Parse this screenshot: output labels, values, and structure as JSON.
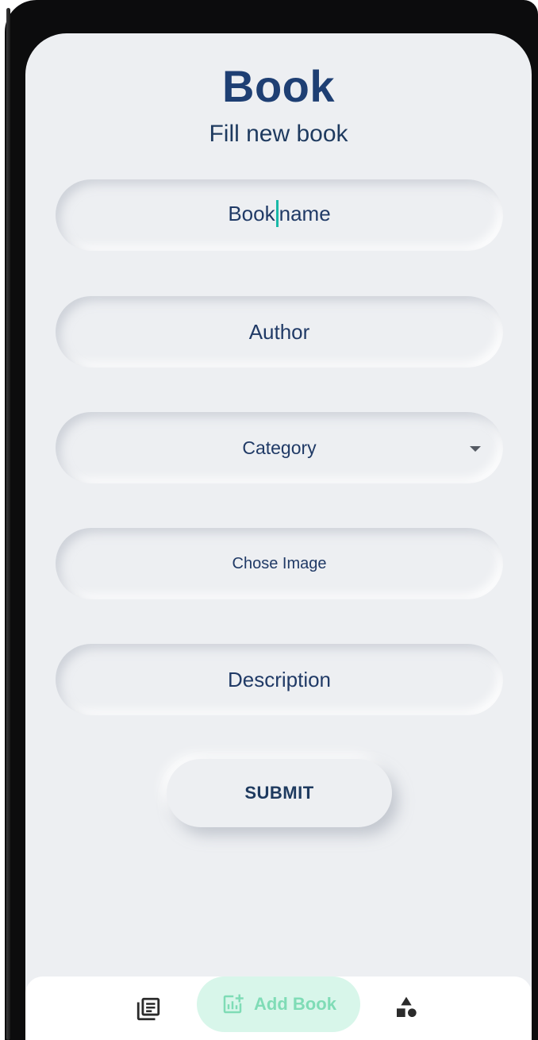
{
  "header": {
    "title": "Book",
    "subtitle": "Fill new book"
  },
  "form": {
    "book_name": {
      "before_cursor": "Book",
      "after_cursor": "name"
    },
    "author": {
      "placeholder": "Author"
    },
    "category": {
      "placeholder": "Category"
    },
    "image": {
      "placeholder": "Chose Image"
    },
    "description": {
      "placeholder": "Description"
    },
    "submit_label": "SUBMIT"
  },
  "bottom_nav": {
    "items": [
      {
        "icon": "library-books-icon",
        "active": false
      },
      {
        "icon": "add-chart-icon",
        "label": "Add Book",
        "active": true
      },
      {
        "icon": "category-shapes-icon",
        "active": false
      }
    ]
  },
  "colors": {
    "background": "#edeff2",
    "title": "#1e3f73",
    "cursor": "#19b9a8",
    "nav_active_bg": "#d8f6ea",
    "nav_active_fg": "#7fdcb6"
  }
}
